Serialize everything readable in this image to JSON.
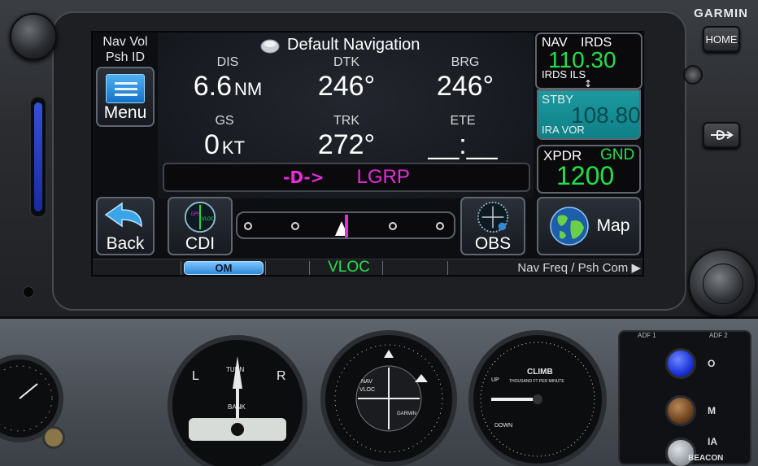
{
  "device": {
    "brand": "GARMIN",
    "home_label": "HOME",
    "direct_to_label": "-D->"
  },
  "left_panel": {
    "knob_hint_line1": "Nav Vol",
    "knob_hint_line2": "Psh ID",
    "menu_label": "Menu",
    "back_label": "Back"
  },
  "nav_page": {
    "title": "Default Navigation",
    "fields": {
      "dis": {
        "label": "DIS",
        "value": "6.6",
        "unit": "NM"
      },
      "dtk": {
        "label": "DTK",
        "value": "246°"
      },
      "brg": {
        "label": "BRG",
        "value": "246°"
      },
      "gs": {
        "label": "GS",
        "value": "0",
        "unit": "KT"
      },
      "trk": {
        "label": "TRK",
        "value": "272°"
      },
      "ete": {
        "label": "ETE",
        "value": "__:__"
      }
    },
    "active_waypoint": {
      "direct_to_symbol": "-D->",
      "name": "LGRP"
    },
    "cdi_label": "CDI",
    "obs_label": "OBS"
  },
  "radios": {
    "nav_label": "NAV",
    "active_id": "IRDS",
    "active_freq": "110.30",
    "active_name": "IRDS ILS",
    "swap_symbol": "↕",
    "standby_label": "STBY",
    "standby_freq": "108.80",
    "standby_name": "IRA VOR"
  },
  "transponder": {
    "label": "XPDR",
    "mode": "GND",
    "code": "1200"
  },
  "map_label": "Map",
  "status_bar": {
    "marker": "OM",
    "nav_source": "VLOC",
    "knob_hint": "Nav Freq / Psh Com ▶"
  },
  "colors": {
    "magenta": "#e82adb",
    "green": "#23e04a",
    "standby_bg": "#1b9aa0",
    "om_blue": "#2f88d8"
  },
  "instrument_panel": {
    "attitude": {
      "left": "L",
      "right": "R",
      "top_text": "TURN",
      "bottom_text": "BANK"
    },
    "nav_indicator": {
      "nav": "NAV",
      "vloc": "VLOC",
      "brand": "GARMIN"
    },
    "vsi": {
      "title": "CLIMB",
      "subtitle": "THOUSAND FT PER MINUTE",
      "up": "UP",
      "down": "DOWN"
    },
    "adf_tag_left": "ADF 1",
    "adf_tag_right": "ADF 2",
    "marker_lamps": {
      "o": "O",
      "m": "M",
      "a": "IA"
    },
    "beacon_label": "BEACON"
  }
}
